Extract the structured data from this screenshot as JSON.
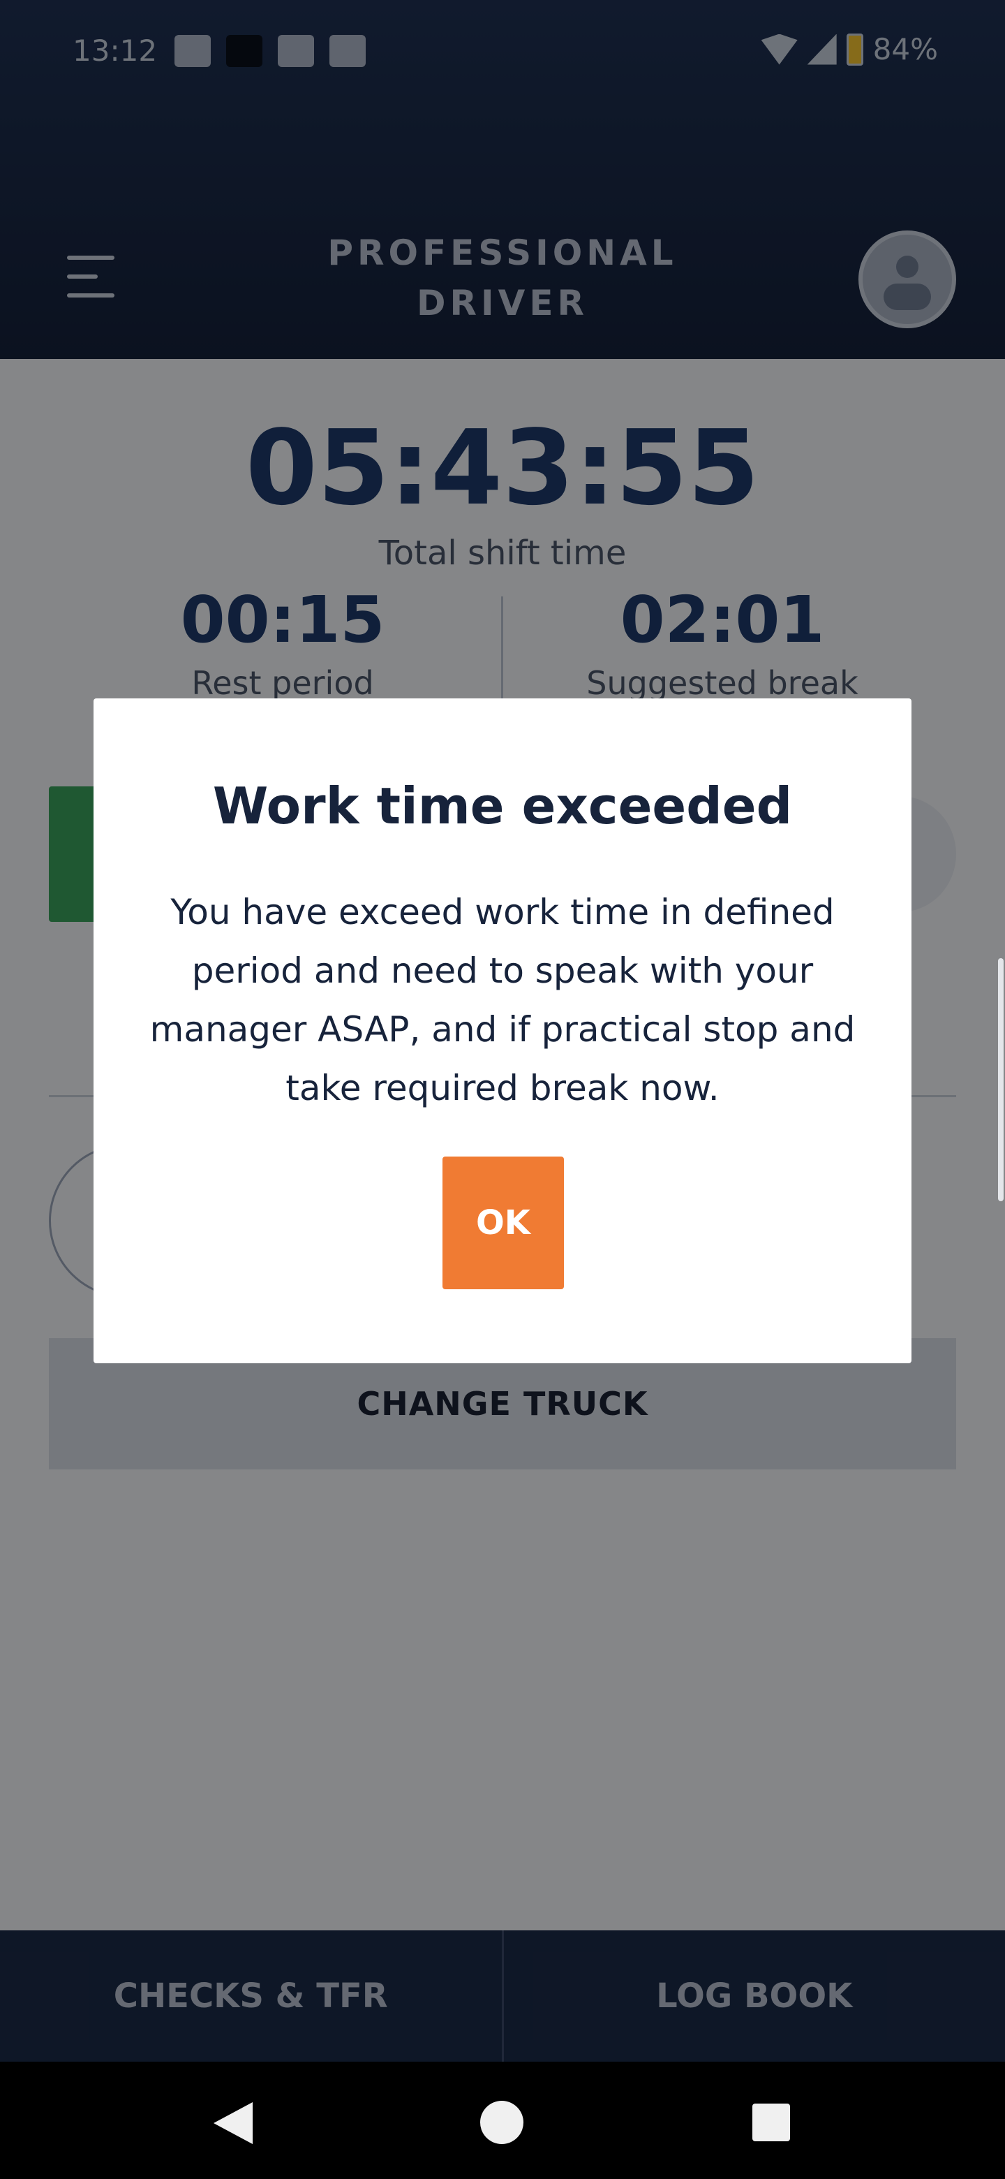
{
  "status_bar": {
    "time": "13:12",
    "battery": "84%"
  },
  "header": {
    "title_line1": "PROFESSIONAL",
    "title_line2": "DRIVER"
  },
  "timer": {
    "total_value": "05:43:55",
    "total_label": "Total shift time"
  },
  "stats": [
    {
      "value": "00:15",
      "label": "Rest period"
    },
    {
      "value": "02:01",
      "label": "Suggested break"
    }
  ],
  "buttons": {
    "change_truck": "CHANGE TRUCK"
  },
  "dialog": {
    "title": "Work time exceeded",
    "message": "You have exceed work time in defined period and need to speak with your manager ASAP, and if practical stop and take required break now.",
    "ok_label": "OK"
  },
  "bottom_nav": [
    {
      "label": "CHECKS & TFR"
    },
    {
      "label": "LOG BOOK"
    }
  ],
  "colors": {
    "header": "#1f3153",
    "ok_button": "#f07b33",
    "value_text": "#1e3a6a",
    "green_action": "#3aa05b"
  }
}
